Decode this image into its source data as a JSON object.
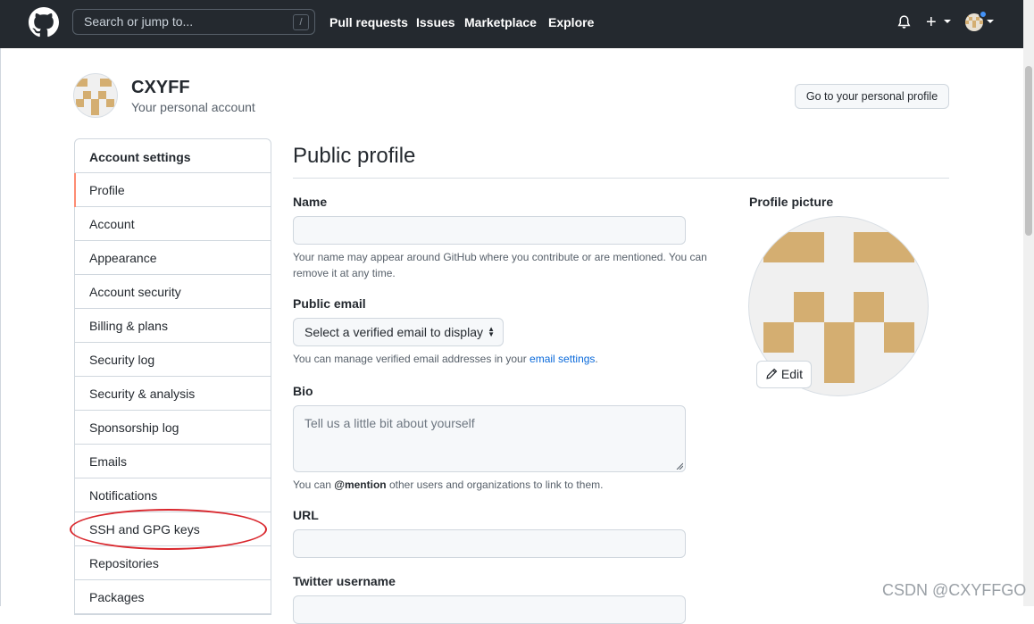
{
  "header": {
    "search_placeholder": "Search or jump to...",
    "search_shortcut": "/",
    "nav": [
      "Pull requests",
      "Issues",
      "Marketplace",
      "Explore"
    ],
    "plus": "+"
  },
  "account": {
    "name": "CXYFF",
    "subtitle": "Your personal account",
    "profile_button": "Go to your personal profile"
  },
  "sidebar": {
    "heading": "Account settings",
    "items": [
      {
        "label": "Profile",
        "active": true
      },
      {
        "label": "Account"
      },
      {
        "label": "Appearance"
      },
      {
        "label": "Account security"
      },
      {
        "label": "Billing & plans"
      },
      {
        "label": "Security log"
      },
      {
        "label": "Security & analysis"
      },
      {
        "label": "Sponsorship log"
      },
      {
        "label": "Emails"
      },
      {
        "label": "Notifications"
      },
      {
        "label": "SSH and GPG keys",
        "highlighted": true
      },
      {
        "label": "Repositories"
      },
      {
        "label": "Packages"
      }
    ]
  },
  "main": {
    "title": "Public profile",
    "name_label": "Name",
    "name_note": "Your name may appear around GitHub where you contribute or are mentioned. You can remove it at any time.",
    "email_label": "Public email",
    "email_select": "Select a verified email to display",
    "email_note_prefix": "You can manage verified email addresses in your ",
    "email_note_link": "email settings",
    "email_note_suffix": ".",
    "bio_label": "Bio",
    "bio_placeholder": "Tell us a little bit about yourself",
    "bio_note_prefix": "You can ",
    "bio_note_mention": "@mention",
    "bio_note_suffix": " other users and organizations to link to them.",
    "url_label": "URL",
    "twitter_label": "Twitter username"
  },
  "profile_picture": {
    "label": "Profile picture",
    "edit_button": "Edit"
  },
  "watermark": "CSDN @CXYFFGO",
  "colors": {
    "header_bg": "#24292f",
    "identicon": "#d4ae71",
    "active_marker": "#fd8c73",
    "annotation": "#d9262c",
    "link": "#0969da"
  }
}
